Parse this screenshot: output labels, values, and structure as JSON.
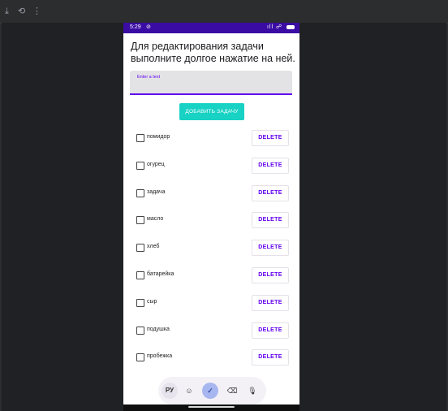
{
  "toolbar": {
    "icons": [
      "download-icon",
      "history-icon",
      "more-vert-icon"
    ]
  },
  "status_bar": {
    "time": "5:29",
    "location_icon": "⊘",
    "right_icons": "ıll ☍",
    "battery_icon": "battery-icon"
  },
  "app": {
    "heading": "Для редактирования задачи выполните долгое нажатие на ней.",
    "input_placeholder": "Enter a text",
    "add_button": "ДОБАВИТЬ ЗАДАЧУ",
    "delete_label": "DELETE",
    "tasks": [
      {
        "label": "помидор"
      },
      {
        "label": "огурец"
      },
      {
        "label": "задача"
      },
      {
        "label": "масло"
      },
      {
        "label": "хлеб"
      },
      {
        "label": "батарейка"
      },
      {
        "label": "сыр"
      },
      {
        "label": "подушка"
      },
      {
        "label": "пробежка"
      }
    ]
  },
  "keyboard": {
    "lang": "РУ",
    "emoji": "☺",
    "check": "✓",
    "backspace": "⌫",
    "mic": "🎙"
  },
  "colors": {
    "status_bar": "#3a0ca3",
    "accent": "#6200ee",
    "add_button": "#18d2c4",
    "emulator_bg": "#202124"
  }
}
